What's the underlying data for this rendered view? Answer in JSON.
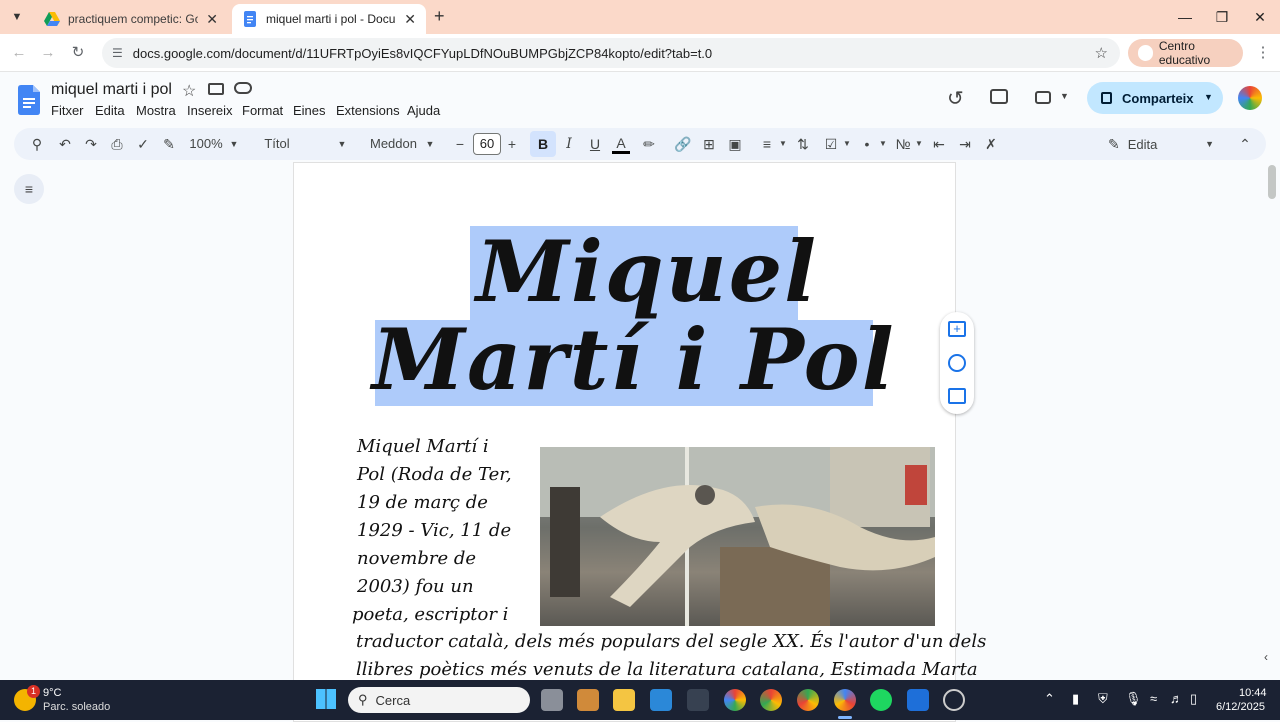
{
  "browser": {
    "tabs": [
      {
        "title": "practiquem competic: Google D",
        "active": false
      },
      {
        "title": "miquel marti i pol - Documents",
        "active": true
      }
    ],
    "new_tab": "+",
    "url": "docs.google.com/document/d/11UFRTpOyiEs8vIQCFYupLDfNOuBUMPGbjZCP84kopto/edit?tab=t.0",
    "profile_label": "Centro educativo"
  },
  "docs": {
    "title": "miquel marti i pol",
    "menus": [
      "Fitxer",
      "Edita",
      "Mostra",
      "Insereix",
      "Format",
      "Eines",
      "Extensions",
      "Ajuda"
    ],
    "share_label": "Comparteix",
    "toolbar": {
      "zoom": "100%",
      "style": "Títol",
      "font": "Meddon",
      "font_size": "60",
      "bold": "B",
      "italic": "I",
      "underline": "U",
      "text_color_glyph": "A",
      "edit_mode": "Edita"
    }
  },
  "document": {
    "title_lines": [
      "Miquel",
      "Martí i Pol"
    ],
    "body_lines": [
      "Miquel Martí i",
      "Pol (Roda de Ter,",
      "19 de març de",
      "1929 - Vic, 11 de",
      "novembre de",
      "2003) fou un",
      "poeta, escriptor i",
      "traductor català, dels més populars del segle XX. És l'autor d'un dels",
      "llibres poètics més venuts de la literatura catalana, Estimada Marta"
    ]
  },
  "taskbar": {
    "weather_temp": "9°C",
    "weather_desc": "Parc. soleado",
    "weather_badge": "1",
    "search_placeholder": "Cerca",
    "time": "10:44",
    "date": "6/12/2025"
  },
  "colors": {
    "tab_strip": "#fbd9c9",
    "highlight": "#aecbfa",
    "share": "#c2e7ff",
    "taskbar": "#1b2233"
  }
}
